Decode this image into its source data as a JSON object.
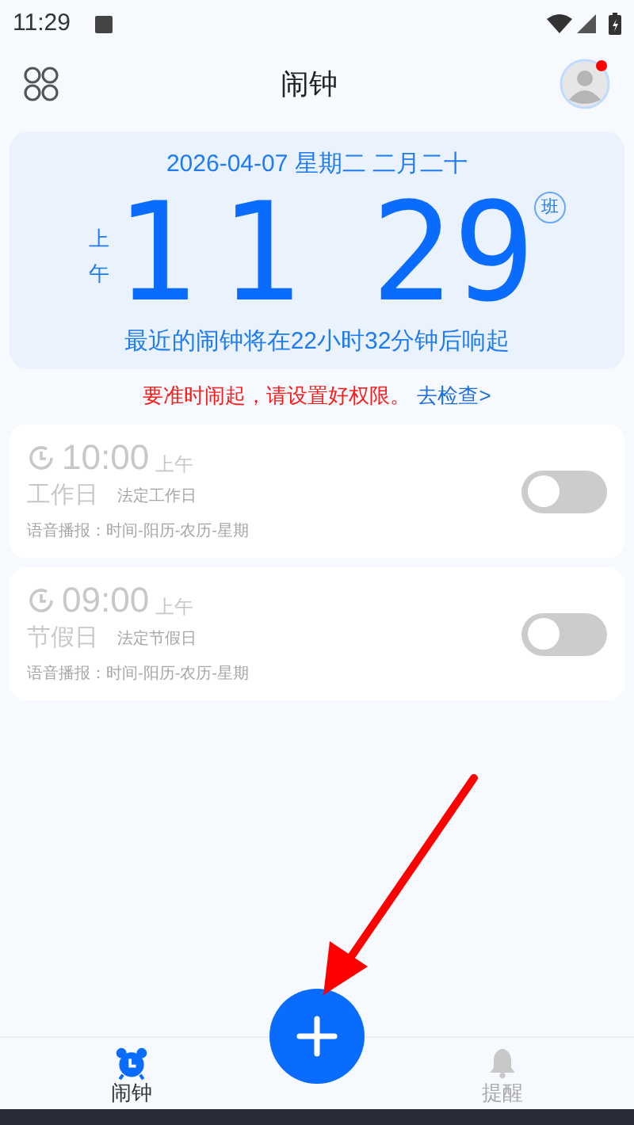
{
  "status_bar": {
    "time": "11:29"
  },
  "header": {
    "title": "闹钟",
    "has_notification": true
  },
  "clock": {
    "date": "2026-04-07 星期二 二月二十",
    "period": "上午",
    "hours": "11",
    "minutes": "29",
    "badge": "班",
    "next_alarm": "最近的闹钟将在22小时32分钟后响起"
  },
  "permission_notice": {
    "message": "要准时闹起，请设置好权限。",
    "link": "去检查>"
  },
  "alarms": [
    {
      "time": "10:00",
      "period": "上午",
      "name": "工作日",
      "tag": "法定工作日",
      "voice": "语音播报：时间-阳历-农历-星期",
      "on": false
    },
    {
      "time": "09:00",
      "period": "上午",
      "name": "节假日",
      "tag": "法定节假日",
      "voice": "语音播报：时间-阳历-农历-星期",
      "on": false
    }
  ],
  "bottom_nav": [
    {
      "label": "闹钟",
      "kind": "alarm",
      "selected": true
    },
    {
      "label": "提醒",
      "kind": "reminder",
      "selected": false
    }
  ]
}
